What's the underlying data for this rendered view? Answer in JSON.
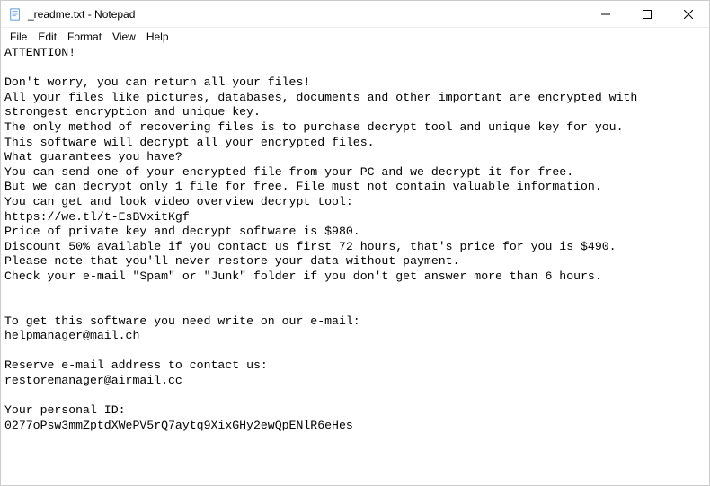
{
  "window": {
    "title": "_readme.txt - Notepad"
  },
  "menu": {
    "file": "File",
    "edit": "Edit",
    "format": "Format",
    "view": "View",
    "help": "Help"
  },
  "document": {
    "text": "ATTENTION!\n\nDon't worry, you can return all your files!\nAll your files like pictures, databases, documents and other important are encrypted with strongest encryption and unique key.\nThe only method of recovering files is to purchase decrypt tool and unique key for you.\nThis software will decrypt all your encrypted files.\nWhat guarantees you have?\nYou can send one of your encrypted file from your PC and we decrypt it for free.\nBut we can decrypt only 1 file for free. File must not contain valuable information.\nYou can get and look video overview decrypt tool:\nhttps://we.tl/t-EsBVxitKgf\nPrice of private key and decrypt software is $980.\nDiscount 50% available if you contact us first 72 hours, that's price for you is $490.\nPlease note that you'll never restore your data without payment.\nCheck your e-mail \"Spam\" or \"Junk\" folder if you don't get answer more than 6 hours.\n\n\nTo get this software you need write on our e-mail:\nhelpmanager@mail.ch\n\nReserve e-mail address to contact us:\nrestoremanager@airmail.cc\n\nYour personal ID:\n0277oPsw3mmZptdXWePV5rQ7aytq9XixGHy2ewQpENlR6eHes"
  }
}
